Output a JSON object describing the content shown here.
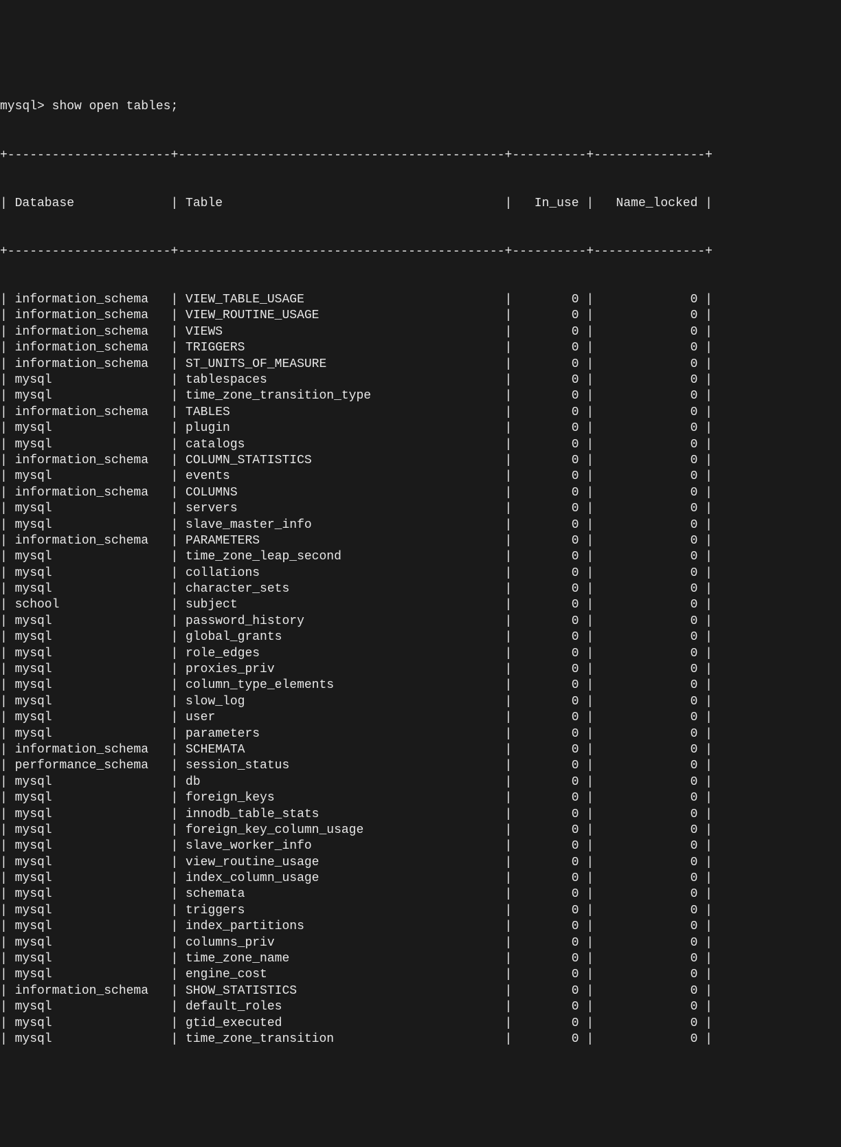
{
  "prompt": "mysql> ",
  "command": "show open tables;",
  "columns": {
    "c0": "Database",
    "c1": "Table",
    "c2": "In_use",
    "c3": "Name_locked"
  },
  "widths": {
    "c0": 20,
    "c1": 42,
    "c2": 8,
    "c3": 13
  },
  "rows": [
    {
      "db": "information_schema",
      "tbl": "VIEW_TABLE_USAGE",
      "in_use": 0,
      "locked": 0
    },
    {
      "db": "information_schema",
      "tbl": "VIEW_ROUTINE_USAGE",
      "in_use": 0,
      "locked": 0
    },
    {
      "db": "information_schema",
      "tbl": "VIEWS",
      "in_use": 0,
      "locked": 0
    },
    {
      "db": "information_schema",
      "tbl": "TRIGGERS",
      "in_use": 0,
      "locked": 0
    },
    {
      "db": "information_schema",
      "tbl": "ST_UNITS_OF_MEASURE",
      "in_use": 0,
      "locked": 0
    },
    {
      "db": "mysql",
      "tbl": "tablespaces",
      "in_use": 0,
      "locked": 0
    },
    {
      "db": "mysql",
      "tbl": "time_zone_transition_type",
      "in_use": 0,
      "locked": 0
    },
    {
      "db": "information_schema",
      "tbl": "TABLES",
      "in_use": 0,
      "locked": 0
    },
    {
      "db": "mysql",
      "tbl": "plugin",
      "in_use": 0,
      "locked": 0
    },
    {
      "db": "mysql",
      "tbl": "catalogs",
      "in_use": 0,
      "locked": 0
    },
    {
      "db": "information_schema",
      "tbl": "COLUMN_STATISTICS",
      "in_use": 0,
      "locked": 0
    },
    {
      "db": "mysql",
      "tbl": "events",
      "in_use": 0,
      "locked": 0
    },
    {
      "db": "information_schema",
      "tbl": "COLUMNS",
      "in_use": 0,
      "locked": 0
    },
    {
      "db": "mysql",
      "tbl": "servers",
      "in_use": 0,
      "locked": 0
    },
    {
      "db": "mysql",
      "tbl": "slave_master_info",
      "in_use": 0,
      "locked": 0
    },
    {
      "db": "information_schema",
      "tbl": "PARAMETERS",
      "in_use": 0,
      "locked": 0
    },
    {
      "db": "mysql",
      "tbl": "time_zone_leap_second",
      "in_use": 0,
      "locked": 0
    },
    {
      "db": "mysql",
      "tbl": "collations",
      "in_use": 0,
      "locked": 0
    },
    {
      "db": "mysql",
      "tbl": "character_sets",
      "in_use": 0,
      "locked": 0
    },
    {
      "db": "school",
      "tbl": "subject",
      "in_use": 0,
      "locked": 0
    },
    {
      "db": "mysql",
      "tbl": "password_history",
      "in_use": 0,
      "locked": 0
    },
    {
      "db": "mysql",
      "tbl": "global_grants",
      "in_use": 0,
      "locked": 0
    },
    {
      "db": "mysql",
      "tbl": "role_edges",
      "in_use": 0,
      "locked": 0
    },
    {
      "db": "mysql",
      "tbl": "proxies_priv",
      "in_use": 0,
      "locked": 0
    },
    {
      "db": "mysql",
      "tbl": "column_type_elements",
      "in_use": 0,
      "locked": 0
    },
    {
      "db": "mysql",
      "tbl": "slow_log",
      "in_use": 0,
      "locked": 0
    },
    {
      "db": "mysql",
      "tbl": "user",
      "in_use": 0,
      "locked": 0
    },
    {
      "db": "mysql",
      "tbl": "parameters",
      "in_use": 0,
      "locked": 0
    },
    {
      "db": "information_schema",
      "tbl": "SCHEMATA",
      "in_use": 0,
      "locked": 0
    },
    {
      "db": "performance_schema",
      "tbl": "session_status",
      "in_use": 0,
      "locked": 0
    },
    {
      "db": "mysql",
      "tbl": "db",
      "in_use": 0,
      "locked": 0
    },
    {
      "db": "mysql",
      "tbl": "foreign_keys",
      "in_use": 0,
      "locked": 0
    },
    {
      "db": "mysql",
      "tbl": "innodb_table_stats",
      "in_use": 0,
      "locked": 0
    },
    {
      "db": "mysql",
      "tbl": "foreign_key_column_usage",
      "in_use": 0,
      "locked": 0
    },
    {
      "db": "mysql",
      "tbl": "slave_worker_info",
      "in_use": 0,
      "locked": 0
    },
    {
      "db": "mysql",
      "tbl": "view_routine_usage",
      "in_use": 0,
      "locked": 0
    },
    {
      "db": "mysql",
      "tbl": "index_column_usage",
      "in_use": 0,
      "locked": 0
    },
    {
      "db": "mysql",
      "tbl": "schemata",
      "in_use": 0,
      "locked": 0
    },
    {
      "db": "mysql",
      "tbl": "triggers",
      "in_use": 0,
      "locked": 0
    },
    {
      "db": "mysql",
      "tbl": "index_partitions",
      "in_use": 0,
      "locked": 0
    },
    {
      "db": "mysql",
      "tbl": "columns_priv",
      "in_use": 0,
      "locked": 0
    },
    {
      "db": "mysql",
      "tbl": "time_zone_name",
      "in_use": 0,
      "locked": 0
    },
    {
      "db": "mysql",
      "tbl": "engine_cost",
      "in_use": 0,
      "locked": 0
    },
    {
      "db": "information_schema",
      "tbl": "SHOW_STATISTICS",
      "in_use": 0,
      "locked": 0
    },
    {
      "db": "mysql",
      "tbl": "default_roles",
      "in_use": 0,
      "locked": 0
    },
    {
      "db": "mysql",
      "tbl": "gtid_executed",
      "in_use": 0,
      "locked": 0
    },
    {
      "db": "mysql",
      "tbl": "time_zone_transition",
      "in_use": 0,
      "locked": 0
    }
  ]
}
